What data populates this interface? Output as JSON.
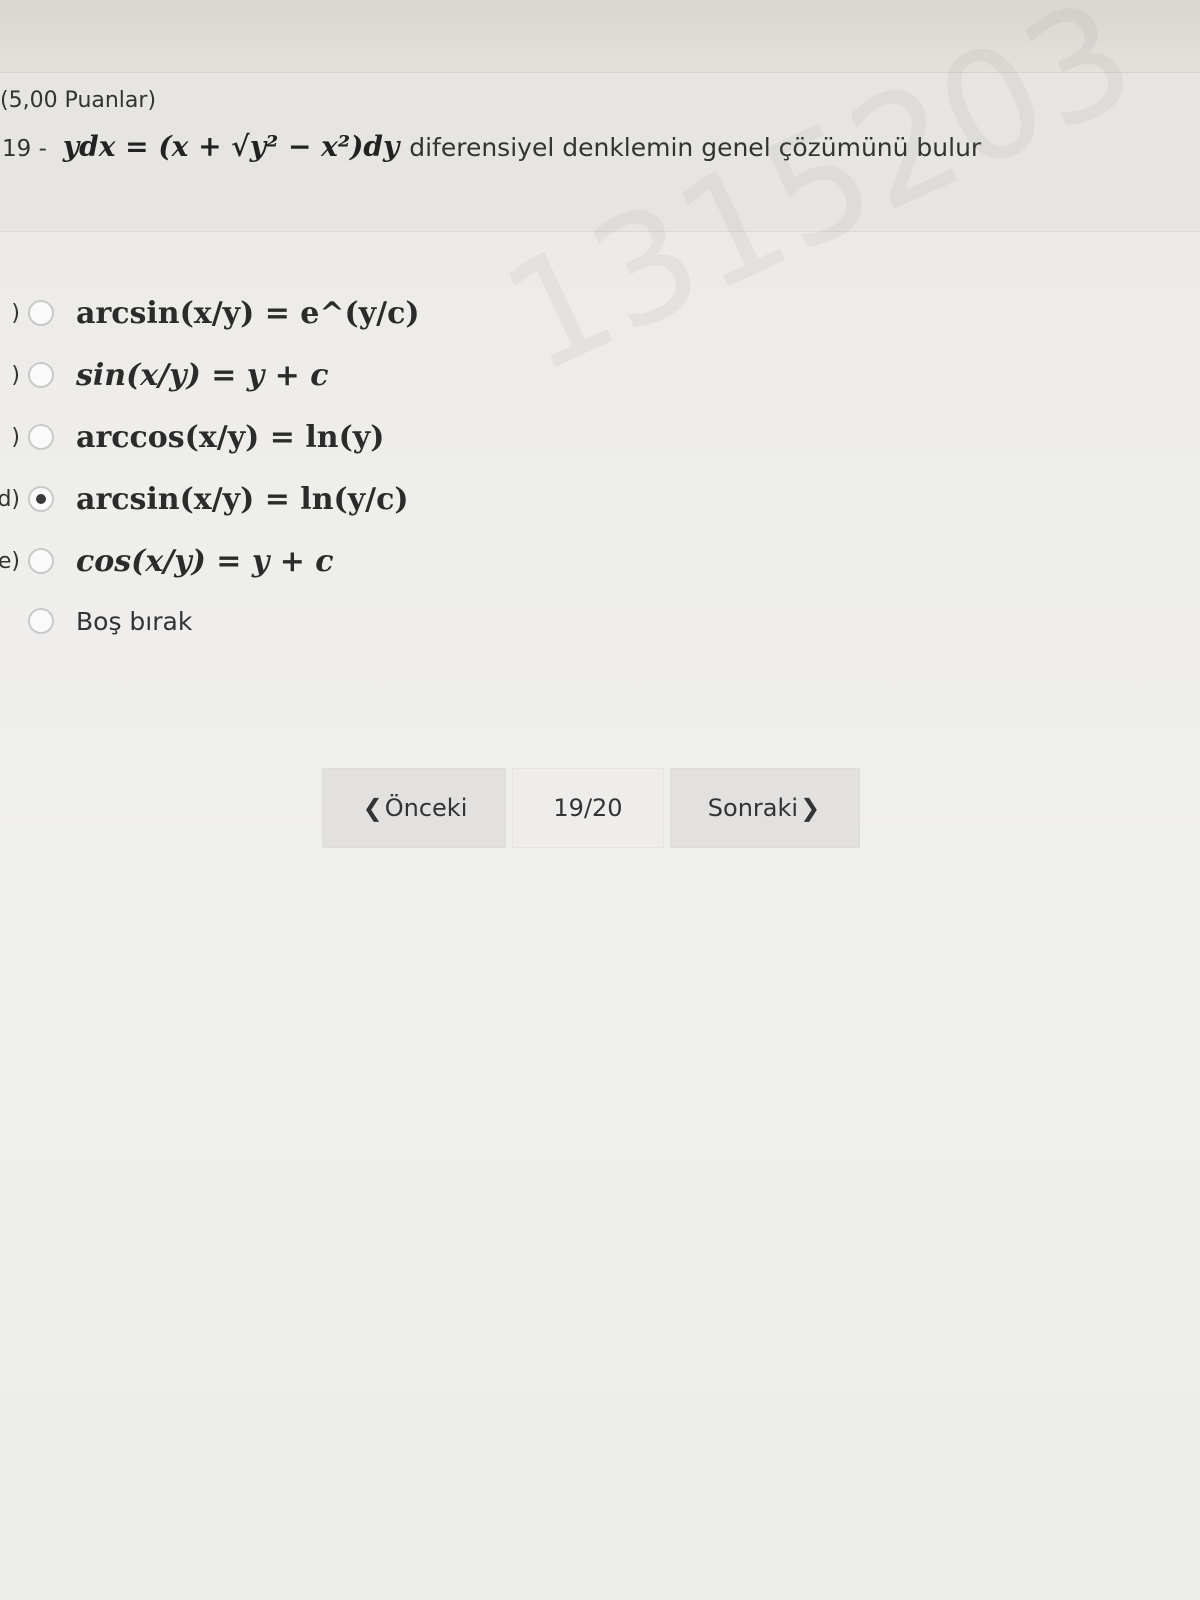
{
  "question": {
    "points": "(5,00 Puanlar)",
    "number": "19 -",
    "equation": "ydx = (x + √y² − x²)dy",
    "prompt": "diferensiyel denklemin genel çözümünü bulur"
  },
  "options": [
    {
      "letter": ")",
      "text": "arcsin(x/y) = e^(y/c)",
      "selected": false
    },
    {
      "letter": ")",
      "text": "sin(x/y) = y + c",
      "selected": false
    },
    {
      "letter": ")",
      "text": "arccos(x/y) = ln(y)",
      "selected": false
    },
    {
      "letter": "d)",
      "text": "arcsin(x/y) = ln(y/c)",
      "selected": true
    },
    {
      "letter": "e)",
      "text": "cos(x/y) = y + c",
      "selected": false
    },
    {
      "letter": "",
      "text": "Boş bırak",
      "selected": false
    }
  ],
  "watermark": "1315203",
  "navigation": {
    "prev_label": "Önceki",
    "page_indicator": "19/20",
    "next_label": "Sonraki"
  }
}
